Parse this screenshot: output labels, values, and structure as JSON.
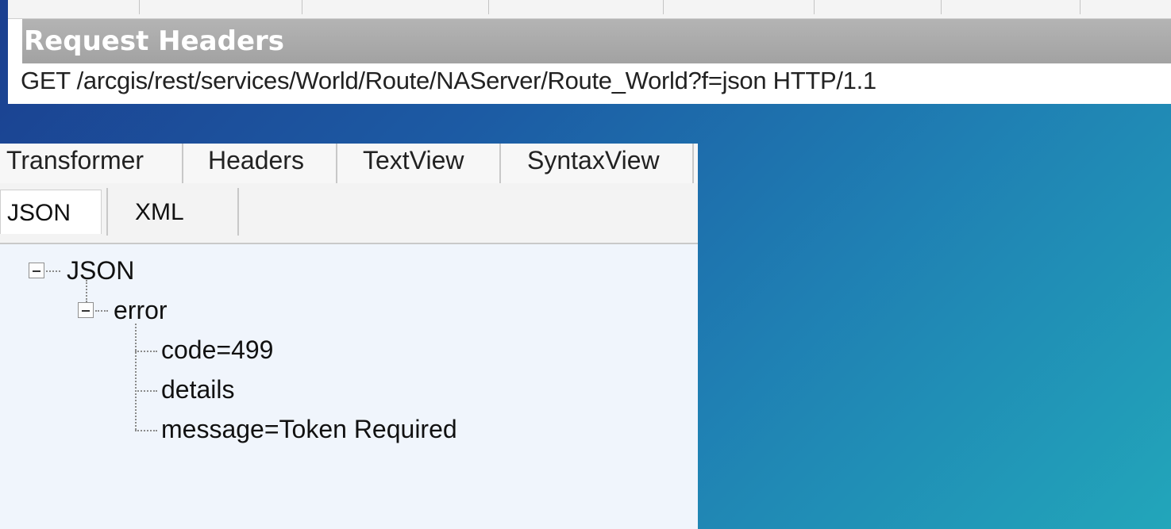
{
  "request": {
    "section_title": "Request Headers",
    "request_line": "GET /arcgis/rest/services/World/Route/NAServer/Route_World?f=json HTTP/1.1"
  },
  "inspector": {
    "tabs": [
      "Transformer",
      "Headers",
      "TextView",
      "SyntaxView"
    ],
    "subtabs": [
      "JSON",
      "XML"
    ],
    "active_subtab": "JSON",
    "tree": {
      "root": "JSON",
      "error": "error",
      "code": "code=499",
      "details": "details",
      "message": "message=Token Required"
    }
  },
  "colors": {
    "header_gray": "#a8a8a8",
    "panel_bg": "#f0f5fc",
    "background_start": "#1b3f8f",
    "background_end": "#22a6ba"
  }
}
